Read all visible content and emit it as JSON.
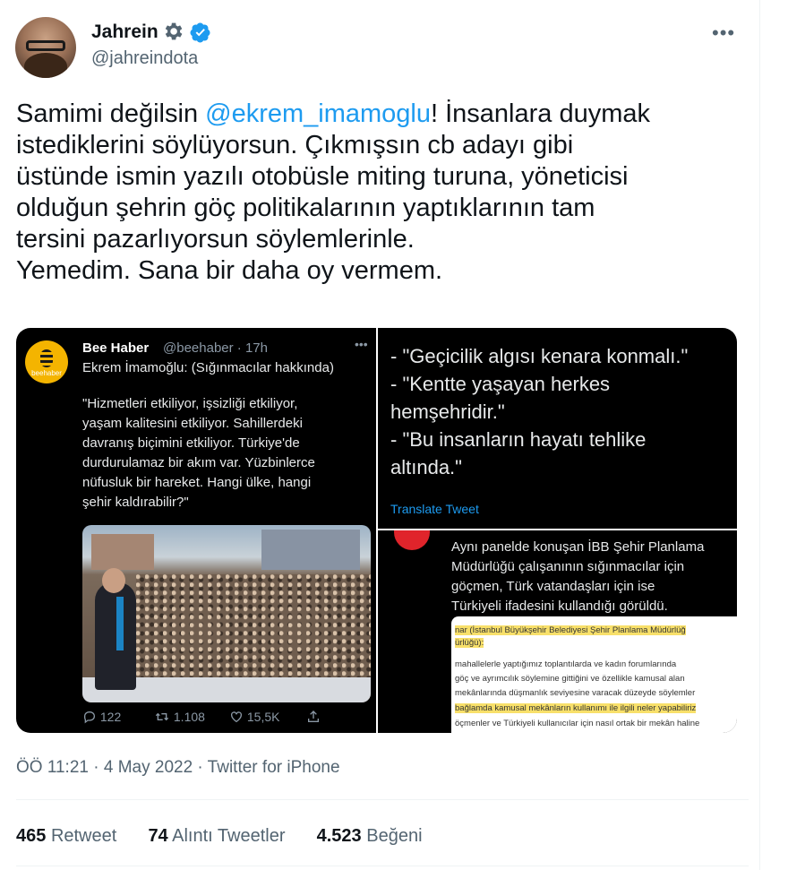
{
  "author": {
    "name": "Jahrein",
    "handle": "@jahreindota"
  },
  "tweet": {
    "text_before": "Samimi değilsin ",
    "mention": "@ekrem_imamoglu",
    "text_after": "! İnsanlara duymak\nistediklerini söylüyorsun. Çıkmışsın cb adayı gibi\nüstünde ismin yazılı otobüsle miting turuna, yöneticisi\nolduğun şehrin göç politikalarının yaptıklarının tam\ntersini pazarlıyorsun söylemlerinle.\nYemedim. Sana bir daha oy vermem."
  },
  "media": {
    "quoted": {
      "logo_text": "beehaber",
      "name": "Bee Haber",
      "handle": "@beehaber · 17h",
      "subtitle": "Ekrem İmamoğlu: (Sığınmacılar hakkında)",
      "quote": "\"Hizmetleri etkiliyor, işsizliği etkiliyor,\nyaşam kalitesini etkiliyor. Sahillerdeki\ndavranış biçimini etkiliyor. Türkiye'de\ndurdurulamaz bir akım var. Yüzbinlerce\nnüfusluk bir hareket. Hangi ülke, hangi\nşehir kaldırabilir?\"",
      "replies": "122",
      "retweets": "1.108",
      "likes": "15,5K"
    },
    "panel2": {
      "list": "- \"Geçicilik algısı kenara konmalı.\"\n- \"Kentte yaşayan herkes\nhemşehridir.\"\n- \"Bu insanların hayatı tehlike\naltında.\"",
      "translate": "Translate Tweet"
    },
    "panel3": {
      "text": "Aynı panelde konuşan İBB Şehir Planlama\nMüdürlüğü çalışanının sığınmacılar için\ngöçmen, Türk vatandaşları için ise\nTürkiyeli ifadesini kullandığı görüldü.",
      "doc_lines": [
        "nar (İstanbul Büyükşehir Belediyesi Şehir Planlama Müdürlüğ",
        "ürlüğü):",
        "mahallelerle yaptığımız toplantılarda ve kadın forumlarında",
        "göç ve ayrımcılık söylemine gittiğini ve özellikle kamusal alan",
        "mekânlarında düşmanlık seviyesine varacak düzeyde söylemler",
        "bağlamda kamusal mekânların kullanımı ile ilgili neler yapabiliriz",
        "öçmenler ve Türkiyeli kullanıcılar için nasıl ortak bir mekân haline"
      ]
    }
  },
  "meta": "ÖÖ 11:21 · 4 May 2022 · Twitter for iPhone",
  "stats": {
    "retweets_count": "465",
    "retweets_label": "Retweet",
    "quotes_count": "74",
    "quotes_label": "Alıntı Tweetler",
    "likes_count": "4.523",
    "likes_label": "Beğeni"
  },
  "colors": {
    "accent": "#1d9bf0",
    "text": "#0f1419",
    "secondary": "#536471"
  },
  "icons": [
    "settings-gear-icon",
    "verified-badge-icon",
    "more-options-icon",
    "reply-icon",
    "retweet-icon",
    "like-icon",
    "share-icon"
  ]
}
